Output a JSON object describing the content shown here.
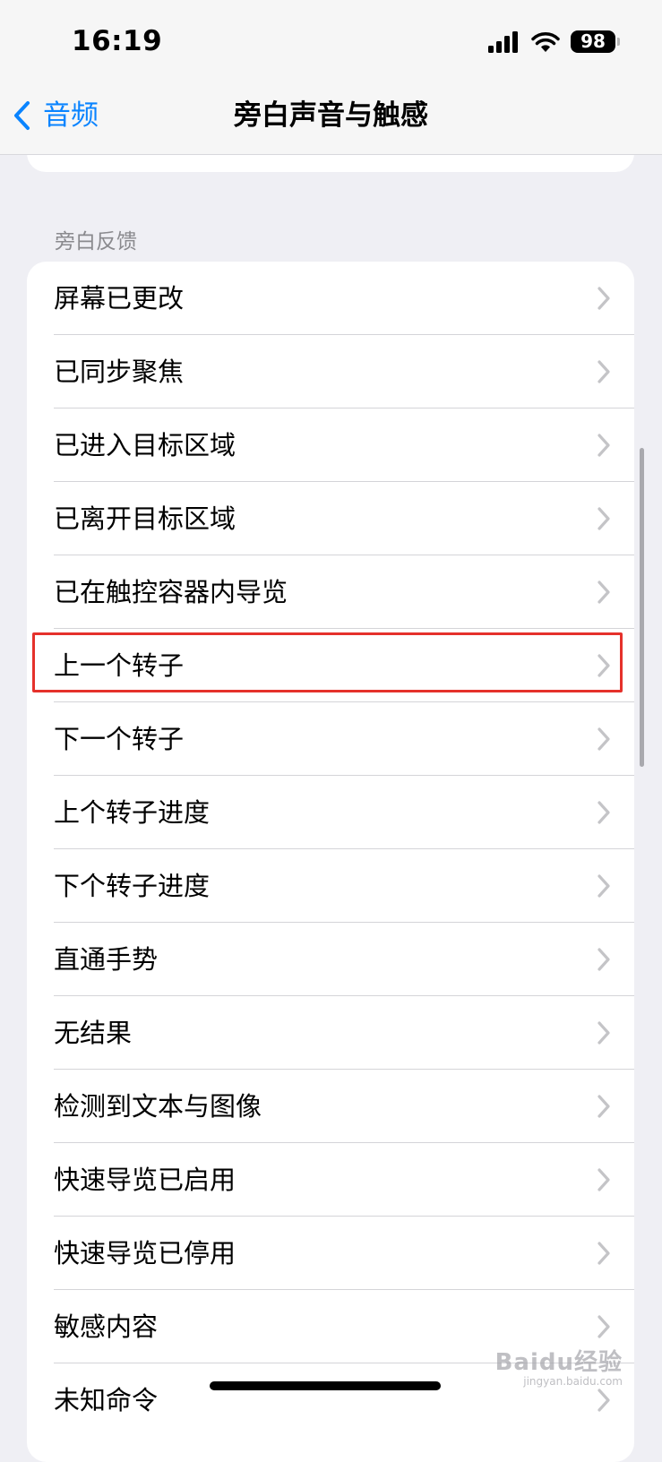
{
  "status_bar": {
    "time": "16:19",
    "battery": "98"
  },
  "nav": {
    "back_label": "音频",
    "title": "旁白声音与触感"
  },
  "section": {
    "header": "旁白反馈",
    "items": [
      {
        "label": "屏幕已更改"
      },
      {
        "label": "已同步聚焦"
      },
      {
        "label": "已进入目标区域"
      },
      {
        "label": "已离开目标区域"
      },
      {
        "label": "已在触控容器内导览"
      },
      {
        "label": "上一个转子"
      },
      {
        "label": "下一个转子"
      },
      {
        "label": "上个转子进度"
      },
      {
        "label": "下个转子进度"
      },
      {
        "label": "直通手势"
      },
      {
        "label": "无结果"
      },
      {
        "label": "检测到文本与图像"
      },
      {
        "label": "快速导览已启用"
      },
      {
        "label": "快速导览已停用"
      },
      {
        "label": "敏感内容"
      },
      {
        "label": "未知命令"
      }
    ],
    "highlighted_item": "上一个转子"
  },
  "watermark": {
    "main": "Baidu经验",
    "sub": "jingyan.baidu.com"
  },
  "colors": {
    "accent": "#0a84ff",
    "highlight": "#e5312b",
    "background": "#efeff4"
  },
  "icons": {
    "back": "chevron-left-icon",
    "row": "chevron-right-icon",
    "signal": "cellular-signal-icon",
    "wifi": "wifi-icon",
    "battery": "battery-icon"
  }
}
